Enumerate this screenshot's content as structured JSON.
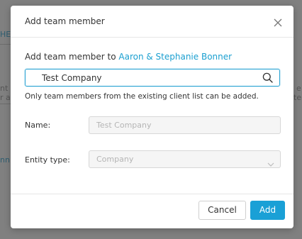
{
  "background": {
    "fragments": [
      {
        "text": "HE",
        "style": "blue"
      },
      {
        "text": "nt s",
        "style": "plain"
      },
      {
        "text": "r ac",
        "style": "plain"
      },
      {
        "text": "nn",
        "style": "blue"
      }
    ],
    "right_fragments": [
      {
        "text": "e"
      },
      {
        "text": "te"
      }
    ]
  },
  "modal": {
    "title": "Add team member",
    "close_icon": "close-icon",
    "subtitle_prefix": "Add team member to ",
    "client_name": "Aaron & Stephanie Bonner",
    "search": {
      "value": "Test Company",
      "icon": "search-icon"
    },
    "hint": "Only team members from the existing client list can be added.",
    "fields": {
      "name_label": "Name:",
      "name_value": "Test Company",
      "entity_label": "Entity type:",
      "entity_value": "Company",
      "entity_icon": "chevron-down-icon"
    },
    "buttons": {
      "cancel": "Cancel",
      "add": "Add"
    }
  },
  "colors": {
    "accent": "#1aa0d6",
    "overlay": "#808080"
  }
}
